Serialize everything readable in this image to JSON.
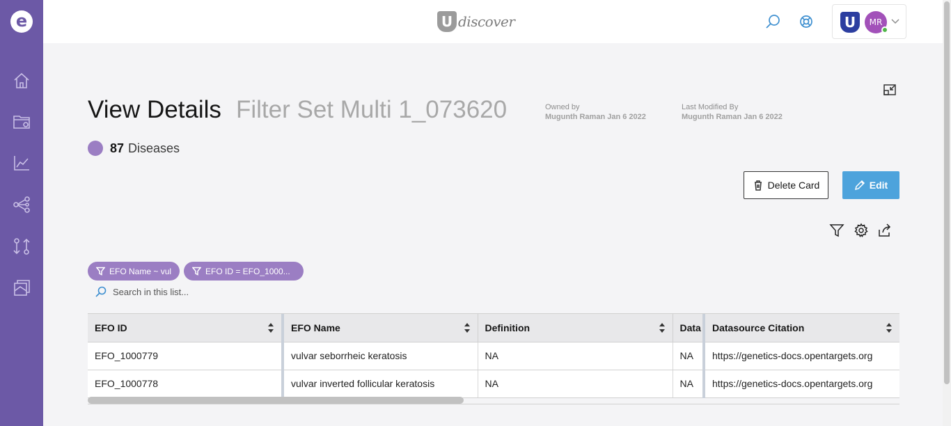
{
  "header": {
    "brand_letter": "U",
    "brand_word": "discover",
    "user_initials": "MR",
    "user_logo_letter": "U"
  },
  "rail": {
    "logo_letter": "e",
    "items": [
      "home-icon",
      "folder-icon",
      "chart-icon",
      "network-icon",
      "compare-icon",
      "cards-icon"
    ]
  },
  "page": {
    "title": "View Details",
    "subtitle": "Filter Set Multi 1_073620",
    "owned_by_label": "Owned by",
    "owned_by_value": "Mugunth Raman Jan 6 2022",
    "modified_label": "Last Modified By",
    "modified_value": "Mugunth Raman Jan 6 2022",
    "count": "87",
    "count_unit": "Diseases",
    "accent": "#9b7ec3"
  },
  "actions": {
    "delete_label": "Delete Card",
    "edit_label": "Edit"
  },
  "filters": [
    {
      "label": "EFO Name ~ vul"
    },
    {
      "label": "EFO ID = EFO_1000..."
    }
  ],
  "search": {
    "placeholder": "Search in this list..."
  },
  "table": {
    "columns": [
      "EFO ID",
      "EFO Name",
      "Definition",
      "Data",
      "Datasource Citation"
    ],
    "rows": [
      [
        "EFO_1000779",
        "vulvar seborrheic keratosis",
        "NA",
        "NA",
        "https://genetics-docs.opentargets.org"
      ],
      [
        "EFO_1000778",
        "vulvar inverted follicular keratosis",
        "NA",
        "NA",
        "https://genetics-docs.opentargets.org"
      ]
    ]
  }
}
